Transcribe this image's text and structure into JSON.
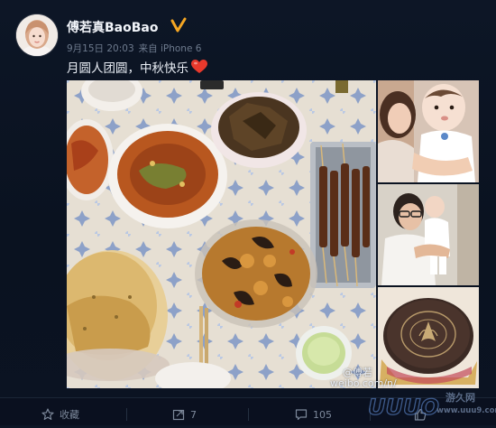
{
  "post": {
    "username": "傅若真BaoBao",
    "meta": {
      "time": "9月15日 20:03",
      "source": "来自 iPhone 6"
    },
    "text": "月圆人团圆，中秋快乐",
    "watermark": "@傅若",
    "watermark_url": "weibo.com/n/"
  },
  "actions": {
    "favorite": {
      "label": "收藏"
    },
    "repost": {
      "count": "7"
    },
    "comment": {
      "count": "105"
    },
    "like": {
      "count": ""
    }
  },
  "site_mark": {
    "logo": "UUUO",
    "name": "游久网",
    "url": "www.uuu9.com"
  },
  "colors": {
    "background": "#0d1626",
    "accent_verified": "#f5a623",
    "muted_text": "#6d7a8d"
  },
  "icons": [
    "verified-badge-icon",
    "heart-emoji-icon",
    "favorite-star-icon",
    "repost-icon",
    "comment-icon",
    "like-thumb-icon"
  ]
}
